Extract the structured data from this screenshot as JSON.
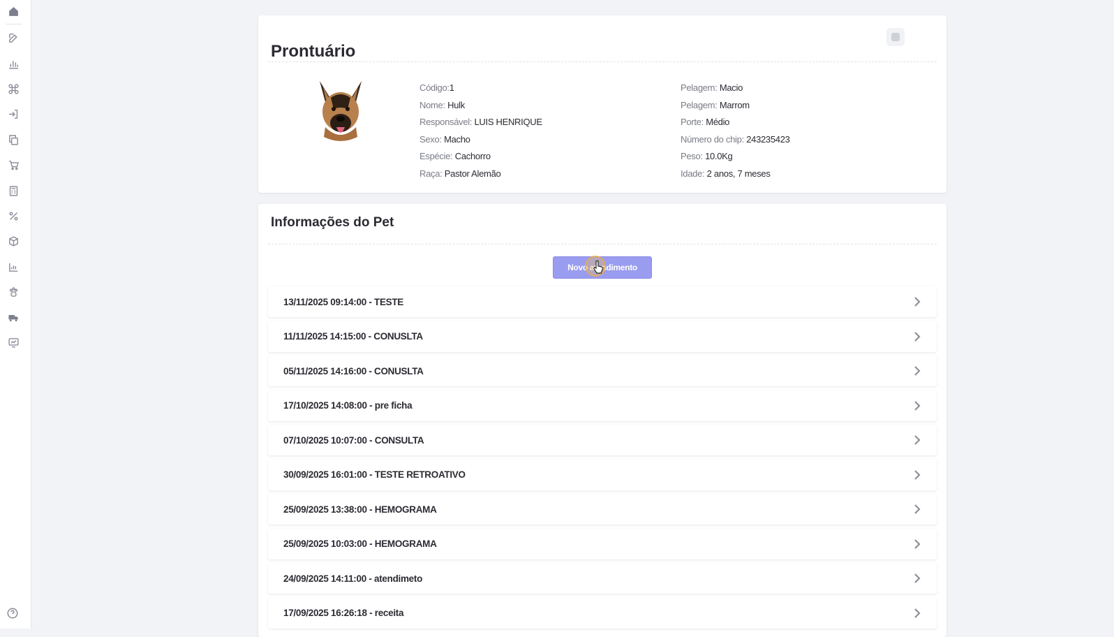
{
  "prontuario": {
    "title": "Prontuário",
    "left_fields": [
      {
        "label": "Código:",
        "value": "1"
      },
      {
        "label": "Nome:",
        "value": "Hulk"
      },
      {
        "label": "Responsável:",
        "value": "LUIS HENRIQUE"
      },
      {
        "label": "Sexo:",
        "value": "Macho"
      },
      {
        "label": "Espécie:",
        "value": "Cachorro"
      },
      {
        "label": "Raça:",
        "value": "Pastor Alemão"
      }
    ],
    "right_fields": [
      {
        "label": "Pelagem:",
        "value": "Macio"
      },
      {
        "label": "Pelagem:",
        "value": "Marrom"
      },
      {
        "label": "Porte:",
        "value": "Médio"
      },
      {
        "label": "Número do chip:",
        "value": "243235423"
      },
      {
        "label": "Peso:",
        "value": "10.0Kg"
      },
      {
        "label": "Idade:",
        "value": "2 anos, 7 meses"
      }
    ]
  },
  "pet_info": {
    "title": "Informações do Pet",
    "new_button_label": "Novo atendimento",
    "records": [
      "13/11/2025 09:14:00 - TESTE",
      "11/11/2025 14:15:00 - CONUSLTA",
      "05/11/2025 14:16:00 - CONUSLTA",
      "17/10/2025 14:08:00 - pre ficha",
      "07/10/2025 10:07:00 - CONSULTA",
      "30/09/2025 16:01:00 - TESTE RETROATIVO",
      "25/09/2025 13:38:00 - HEMOGRAMA",
      "25/09/2025 10:03:00 - HEMOGRAMA",
      "24/09/2025 14:11:00 - atendimeto",
      "17/09/2025 16:26:18 - receita"
    ]
  },
  "icons": {
    "sidebar": [
      "home-icon",
      "edit-icon",
      "bar-chart-icon",
      "command-icon",
      "login-icon",
      "copy-icon",
      "cart-icon",
      "calculator-icon",
      "percent-icon",
      "box-icon",
      "chart-icon",
      "paw-icon",
      "truck-icon",
      "monitor-chart-icon"
    ],
    "help": "help-icon",
    "row_chevron": "chevron-right-icon"
  },
  "colors": {
    "accent": "#9a9cf0",
    "background": "#f2f3f6"
  }
}
